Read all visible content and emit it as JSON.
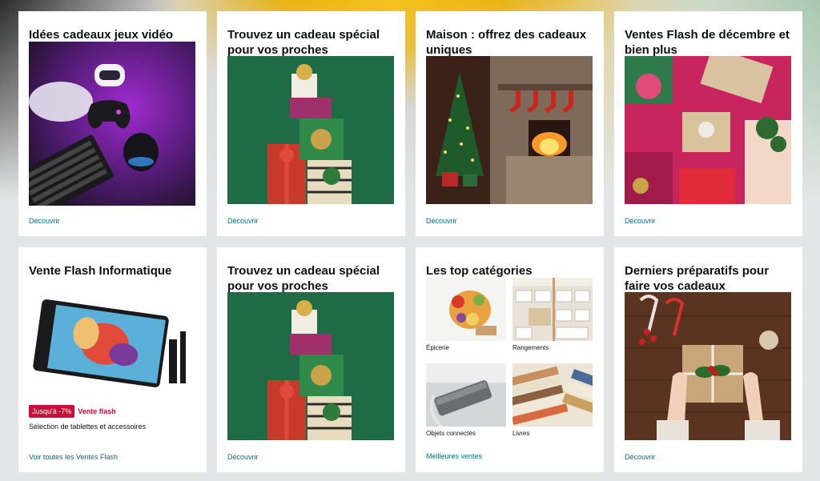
{
  "cards": [
    {
      "title": "Idées cadeaux jeux vidéo",
      "link": "Découvrir"
    },
    {
      "title": "Trouvez un cadeau spécial pour vos proches",
      "link": "Découvrir"
    },
    {
      "title": "Maison : offrez des cadeaux uniques",
      "link": "Découvrir"
    },
    {
      "title": "Ventes Flash de décembre et bien plus",
      "link": "Découvrir"
    },
    {
      "title": "Vente Flash Informatique",
      "link": "Voir toutes les Ventes Flash",
      "badge": "Jusqu'à -7%",
      "deal_label": "Vente flash",
      "deal_desc": "Sélection de tablettes et accessoires"
    },
    {
      "title": "Trouvez un cadeau spécial pour vos proches",
      "link": "Découvrir"
    },
    {
      "title": "Les top catégories",
      "link": "Meilleures ventes",
      "categories": [
        "Épicerie",
        "Rangements",
        "Objets connectés",
        "Livres"
      ]
    },
    {
      "title": "Derniers préparatifs pour faire vos cadeaux",
      "link": "Découvrir"
    }
  ],
  "colors": {
    "link": "#007185",
    "badge": "#cc0c39",
    "background": "#e3e6e6"
  }
}
